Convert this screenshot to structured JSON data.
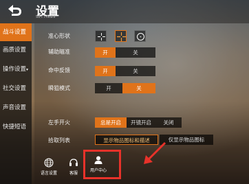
{
  "header": {
    "back_icon": "back-arrow-icon",
    "title": "设置",
    "subtitle": "SETTINGS"
  },
  "sidebar": {
    "items": [
      {
        "label": "战斗设置",
        "active": true
      },
      {
        "label": "画质设置",
        "active": false
      },
      {
        "label": "操作设置",
        "active": false,
        "has_dropdown": true
      },
      {
        "label": "社交设置",
        "active": false
      },
      {
        "label": "声音设置",
        "active": false
      },
      {
        "label": "快捷短语",
        "active": false
      }
    ]
  },
  "settings": {
    "crosshair": {
      "label": "准心形状",
      "options": [
        "crosshair-small-icon",
        "crosshair-large-icon",
        "crosshair-circle-icon"
      ],
      "selected_index": 1
    },
    "aim_assist": {
      "label": "辅助瞄准",
      "on": "开",
      "off": "关",
      "value": "开"
    },
    "hit_feedback": {
      "label": "命中反馈",
      "on": "开",
      "off": "关",
      "value": "开"
    },
    "scope_mode": {
      "label": "瞬狙模式",
      "on": "开",
      "off": "关",
      "value": "关"
    },
    "left_fire": {
      "label": "左手开火",
      "options": [
        "总是开启",
        "开镜开启",
        "关闭"
      ],
      "value": "总是开启"
    },
    "pickup_list": {
      "label": "拾取列表",
      "options": [
        "显示物品图标和描述",
        "仅显示物品图标"
      ],
      "value": "显示物品图标和描述"
    }
  },
  "bottom": {
    "language": {
      "label": "语言设置",
      "icon": "globe-icon"
    },
    "service": {
      "label": "客服",
      "icon": "headset-icon"
    },
    "user_center": {
      "label": "用户中心",
      "icon": "user-icon"
    }
  },
  "colors": {
    "accent": "#e0731a",
    "highlight": "#e8322a"
  }
}
